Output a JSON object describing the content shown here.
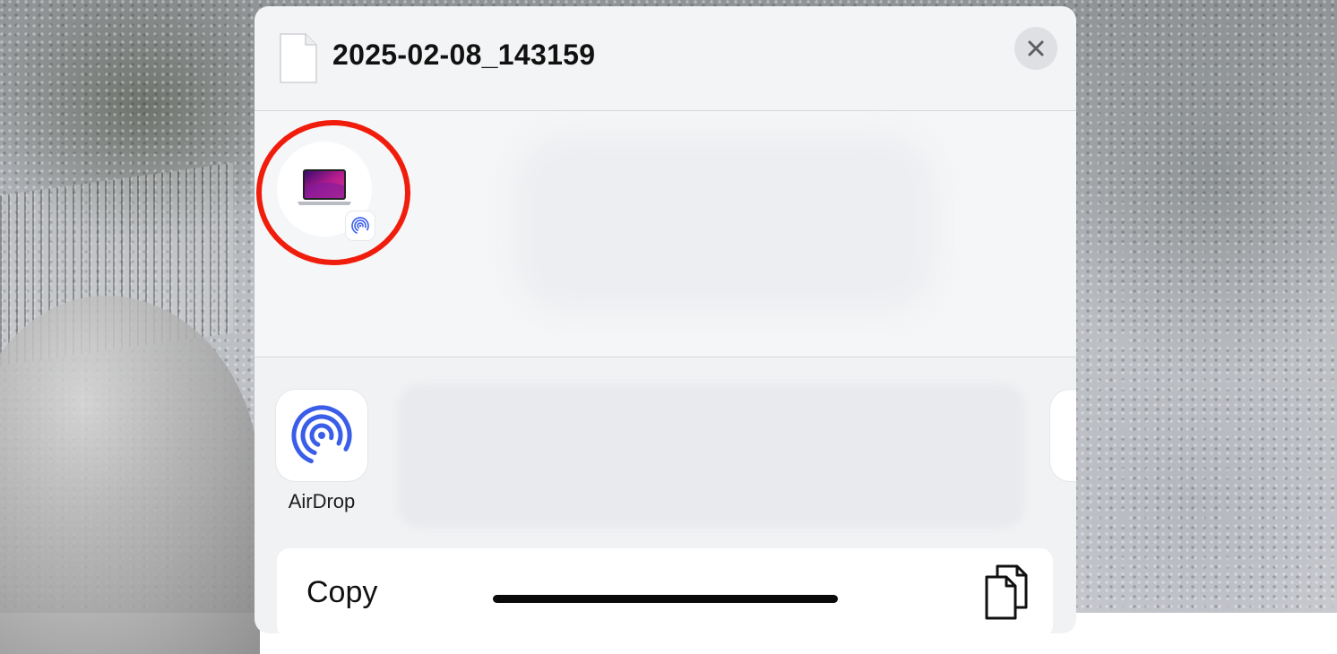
{
  "share_sheet": {
    "file_name": "2025-02-08_143159",
    "file_icon": "document-icon",
    "close_icon": "close-icon"
  },
  "airdrop_device": {
    "device_icon": "macbook-icon",
    "badge_icon": "airdrop-icon",
    "highlight_color": "#f01c0c"
  },
  "apps": [
    {
      "label": "AirDrop",
      "icon": "airdrop-icon",
      "accent": "#3b5ee8"
    },
    {
      "label": "",
      "icon": "app-icon"
    }
  ],
  "actions": [
    {
      "label": "Copy",
      "icon": "copy-icon"
    }
  ]
}
